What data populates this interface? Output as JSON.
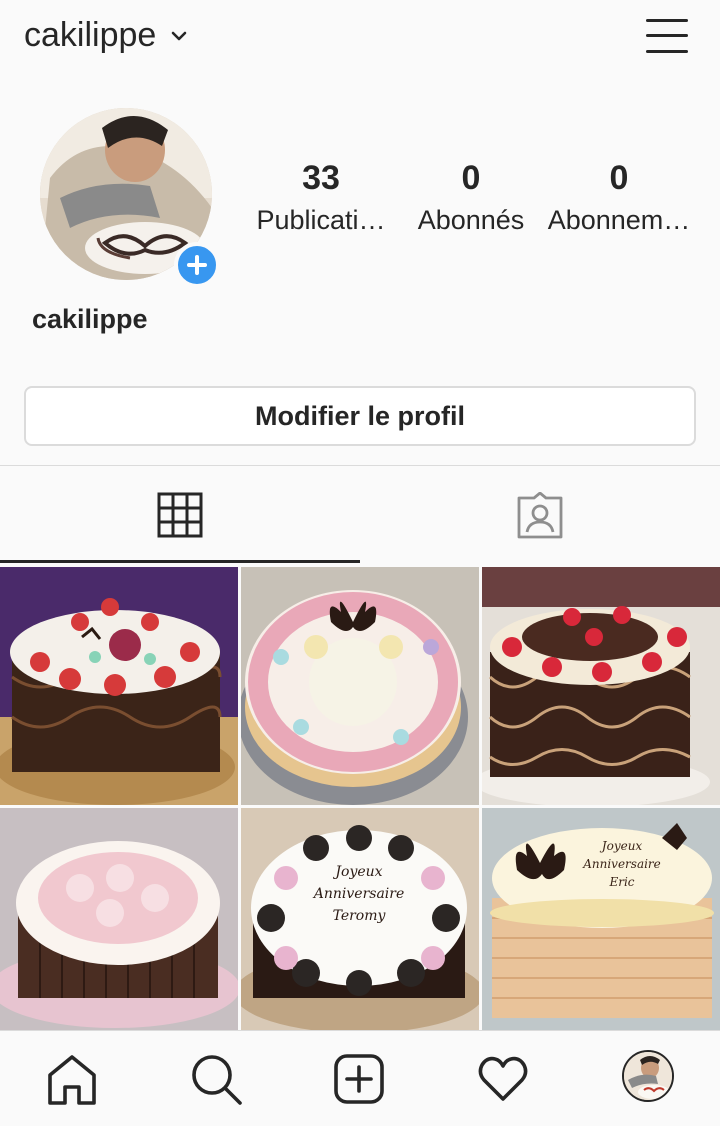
{
  "header": {
    "username": "cakilippe",
    "caret_icon": "chevron-down-icon",
    "menu_icon": "hamburger-menu-icon"
  },
  "profile": {
    "display_name": "cakilippe",
    "add_story_icon": "plus-icon",
    "stats": [
      {
        "value": "33",
        "label": "Publicati…"
      },
      {
        "value": "0",
        "label": "Abonnés"
      },
      {
        "value": "0",
        "label": "Abonnem…"
      }
    ],
    "edit_button": "Modifier le profil"
  },
  "tabs": [
    {
      "icon": "grid-icon",
      "active": true
    },
    {
      "icon": "tagged-photos-icon",
      "active": false
    }
  ],
  "posts": [
    {
      "alt": "chocolate lace cake with strawberries"
    },
    {
      "alt": "pink and cream rosette cake with chocolate butterfly"
    },
    {
      "alt": "chocolate lace cake with strawberries"
    },
    {
      "alt": "white rosette cake with chocolate fingers"
    },
    {
      "alt": "cake with Oreo and pink rosettes",
      "text": "Joyeux Anniversaire Teromy"
    },
    {
      "alt": "cream cake with chocolate butterflies",
      "text": "Joyeux Anniversaire Eric"
    }
  ],
  "bottom_nav": [
    {
      "icon": "home-icon"
    },
    {
      "icon": "search-icon"
    },
    {
      "icon": "new-post-icon"
    },
    {
      "icon": "heart-icon"
    },
    {
      "icon": "profile-avatar-icon"
    }
  ],
  "colors": {
    "accent": "#3897f0",
    "text": "#262626",
    "border": "#dbdbdb",
    "background": "#fafafa"
  }
}
